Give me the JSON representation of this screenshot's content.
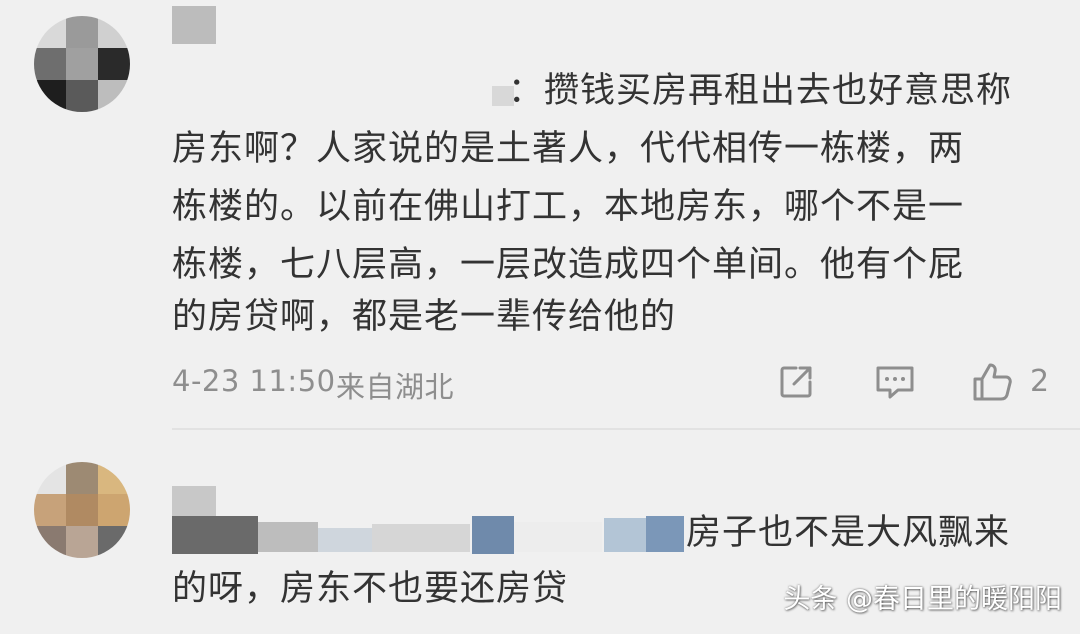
{
  "comments": [
    {
      "lines": [
        "：攒钱买房再租出去也好意思称",
        "房东啊？人家说的是土著人，代代相传一栋楼，两",
        "栋楼的。以前在佛山打工，本地房东，哪个不是一",
        "栋楼，七八层高，一层改造成四个单间。他有个屁",
        "的房贷啊，都是老一辈传给他的"
      ],
      "timestamp": "4-23 11:50",
      "location": "来自湖北",
      "like_count": "2"
    },
    {
      "lines": [
        "房子也不是大风飘来",
        "的呀，房东不也要还房贷"
      ]
    }
  ],
  "watermark": "头条 @春日里的暖阳阳",
  "icons": [
    "share-icon",
    "comment-icon",
    "like-icon"
  ]
}
